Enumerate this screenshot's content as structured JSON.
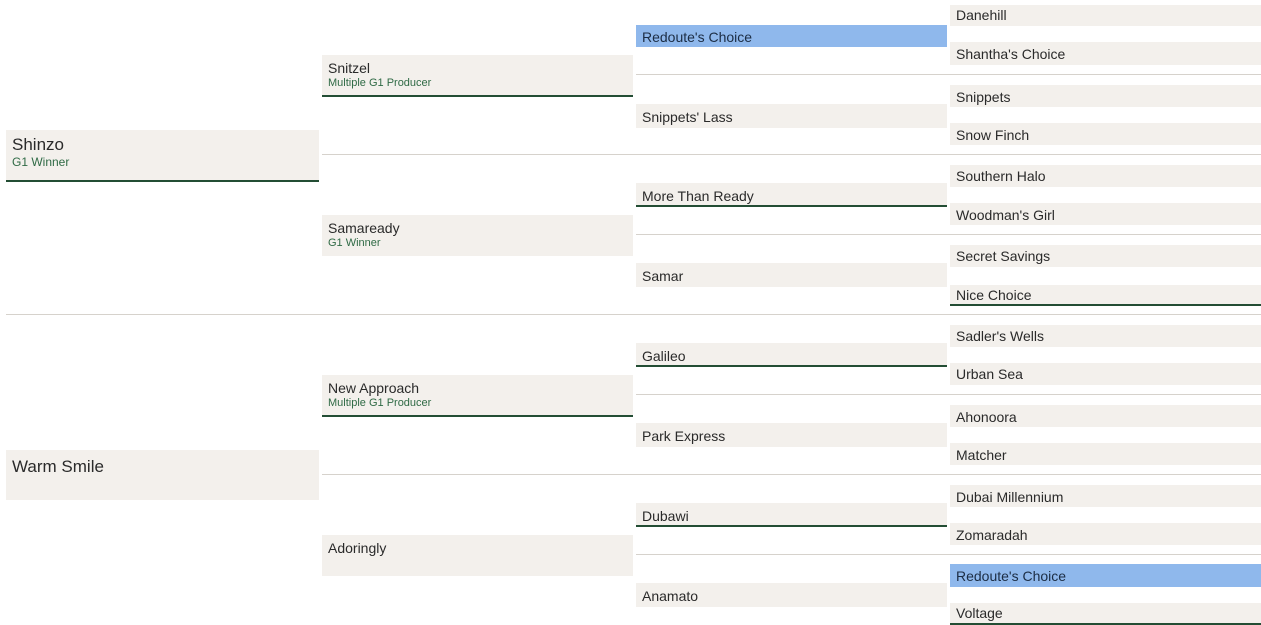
{
  "sire": {
    "name": "Shinzo",
    "note": "G1 Winner"
  },
  "dam": {
    "name": "Warm Smile"
  },
  "sire_sire": {
    "name": "Snitzel",
    "note": "Multiple G1 Producer"
  },
  "sire_dam": {
    "name": "Samaready",
    "note": "G1 Winner"
  },
  "dam_sire": {
    "name": "New Approach",
    "note": "Multiple G1 Producer"
  },
  "dam_dam": {
    "name": "Adoringly"
  },
  "gen3": [
    {
      "name": "Redoute's Choice"
    },
    {
      "name": "Snippets' Lass"
    },
    {
      "name": "More Than Ready"
    },
    {
      "name": "Samar"
    },
    {
      "name": "Galileo"
    },
    {
      "name": "Park Express"
    },
    {
      "name": "Dubawi"
    },
    {
      "name": "Anamato"
    }
  ],
  "gen4": [
    {
      "name": "Danehill"
    },
    {
      "name": "Shantha's Choice"
    },
    {
      "name": "Snippets"
    },
    {
      "name": "Snow Finch"
    },
    {
      "name": "Southern Halo"
    },
    {
      "name": "Woodman's Girl"
    },
    {
      "name": "Secret Savings"
    },
    {
      "name": "Nice Choice"
    },
    {
      "name": "Sadler's Wells"
    },
    {
      "name": "Urban Sea"
    },
    {
      "name": "Ahonoora"
    },
    {
      "name": "Matcher"
    },
    {
      "name": "Dubai Millennium"
    },
    {
      "name": "Zomaradah"
    },
    {
      "name": "Redoute's Choice"
    },
    {
      "name": "Voltage"
    }
  ],
  "colors": {
    "highlight": "#8fb8ec",
    "underline": "#234d34",
    "cell_bg": "#f3f0ec",
    "note_text": "#2f6a45"
  }
}
